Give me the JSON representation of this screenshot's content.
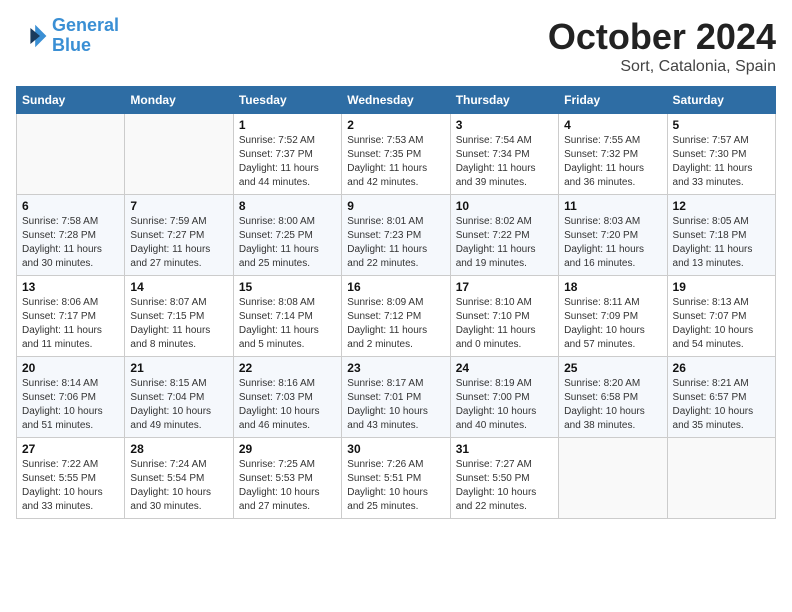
{
  "header": {
    "logo_line1": "General",
    "logo_line2": "Blue",
    "month": "October 2024",
    "location": "Sort, Catalonia, Spain"
  },
  "columns": [
    "Sunday",
    "Monday",
    "Tuesday",
    "Wednesday",
    "Thursday",
    "Friday",
    "Saturday"
  ],
  "weeks": [
    [
      {
        "day": "",
        "info": ""
      },
      {
        "day": "",
        "info": ""
      },
      {
        "day": "1",
        "info": "Sunrise: 7:52 AM\nSunset: 7:37 PM\nDaylight: 11 hours and 44 minutes."
      },
      {
        "day": "2",
        "info": "Sunrise: 7:53 AM\nSunset: 7:35 PM\nDaylight: 11 hours and 42 minutes."
      },
      {
        "day": "3",
        "info": "Sunrise: 7:54 AM\nSunset: 7:34 PM\nDaylight: 11 hours and 39 minutes."
      },
      {
        "day": "4",
        "info": "Sunrise: 7:55 AM\nSunset: 7:32 PM\nDaylight: 11 hours and 36 minutes."
      },
      {
        "day": "5",
        "info": "Sunrise: 7:57 AM\nSunset: 7:30 PM\nDaylight: 11 hours and 33 minutes."
      }
    ],
    [
      {
        "day": "6",
        "info": "Sunrise: 7:58 AM\nSunset: 7:28 PM\nDaylight: 11 hours and 30 minutes."
      },
      {
        "day": "7",
        "info": "Sunrise: 7:59 AM\nSunset: 7:27 PM\nDaylight: 11 hours and 27 minutes."
      },
      {
        "day": "8",
        "info": "Sunrise: 8:00 AM\nSunset: 7:25 PM\nDaylight: 11 hours and 25 minutes."
      },
      {
        "day": "9",
        "info": "Sunrise: 8:01 AM\nSunset: 7:23 PM\nDaylight: 11 hours and 22 minutes."
      },
      {
        "day": "10",
        "info": "Sunrise: 8:02 AM\nSunset: 7:22 PM\nDaylight: 11 hours and 19 minutes."
      },
      {
        "day": "11",
        "info": "Sunrise: 8:03 AM\nSunset: 7:20 PM\nDaylight: 11 hours and 16 minutes."
      },
      {
        "day": "12",
        "info": "Sunrise: 8:05 AM\nSunset: 7:18 PM\nDaylight: 11 hours and 13 minutes."
      }
    ],
    [
      {
        "day": "13",
        "info": "Sunrise: 8:06 AM\nSunset: 7:17 PM\nDaylight: 11 hours and 11 minutes."
      },
      {
        "day": "14",
        "info": "Sunrise: 8:07 AM\nSunset: 7:15 PM\nDaylight: 11 hours and 8 minutes."
      },
      {
        "day": "15",
        "info": "Sunrise: 8:08 AM\nSunset: 7:14 PM\nDaylight: 11 hours and 5 minutes."
      },
      {
        "day": "16",
        "info": "Sunrise: 8:09 AM\nSunset: 7:12 PM\nDaylight: 11 hours and 2 minutes."
      },
      {
        "day": "17",
        "info": "Sunrise: 8:10 AM\nSunset: 7:10 PM\nDaylight: 11 hours and 0 minutes."
      },
      {
        "day": "18",
        "info": "Sunrise: 8:11 AM\nSunset: 7:09 PM\nDaylight: 10 hours and 57 minutes."
      },
      {
        "day": "19",
        "info": "Sunrise: 8:13 AM\nSunset: 7:07 PM\nDaylight: 10 hours and 54 minutes."
      }
    ],
    [
      {
        "day": "20",
        "info": "Sunrise: 8:14 AM\nSunset: 7:06 PM\nDaylight: 10 hours and 51 minutes."
      },
      {
        "day": "21",
        "info": "Sunrise: 8:15 AM\nSunset: 7:04 PM\nDaylight: 10 hours and 49 minutes."
      },
      {
        "day": "22",
        "info": "Sunrise: 8:16 AM\nSunset: 7:03 PM\nDaylight: 10 hours and 46 minutes."
      },
      {
        "day": "23",
        "info": "Sunrise: 8:17 AM\nSunset: 7:01 PM\nDaylight: 10 hours and 43 minutes."
      },
      {
        "day": "24",
        "info": "Sunrise: 8:19 AM\nSunset: 7:00 PM\nDaylight: 10 hours and 40 minutes."
      },
      {
        "day": "25",
        "info": "Sunrise: 8:20 AM\nSunset: 6:58 PM\nDaylight: 10 hours and 38 minutes."
      },
      {
        "day": "26",
        "info": "Sunrise: 8:21 AM\nSunset: 6:57 PM\nDaylight: 10 hours and 35 minutes."
      }
    ],
    [
      {
        "day": "27",
        "info": "Sunrise: 7:22 AM\nSunset: 5:55 PM\nDaylight: 10 hours and 33 minutes."
      },
      {
        "day": "28",
        "info": "Sunrise: 7:24 AM\nSunset: 5:54 PM\nDaylight: 10 hours and 30 minutes."
      },
      {
        "day": "29",
        "info": "Sunrise: 7:25 AM\nSunset: 5:53 PM\nDaylight: 10 hours and 27 minutes."
      },
      {
        "day": "30",
        "info": "Sunrise: 7:26 AM\nSunset: 5:51 PM\nDaylight: 10 hours and 25 minutes."
      },
      {
        "day": "31",
        "info": "Sunrise: 7:27 AM\nSunset: 5:50 PM\nDaylight: 10 hours and 22 minutes."
      },
      {
        "day": "",
        "info": ""
      },
      {
        "day": "",
        "info": ""
      }
    ]
  ]
}
